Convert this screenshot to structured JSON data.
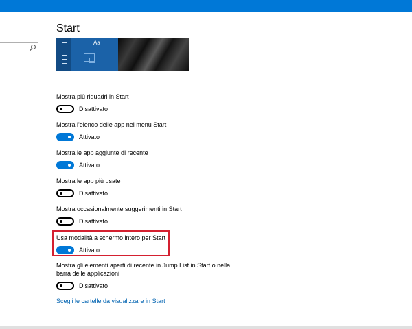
{
  "page": {
    "title": "Start"
  },
  "search": {
    "value": "",
    "placeholder": "",
    "icon": "search-icon"
  },
  "preview": {
    "tile_label": "Aa"
  },
  "settings": [
    {
      "label": "Mostra più riquadri in Start",
      "state": "Disattivato",
      "on": false
    },
    {
      "label": "Mostra l'elenco delle app nel menu Start",
      "state": "Attivato",
      "on": true
    },
    {
      "label": "Mostra le app aggiunte di recente",
      "state": "Attivato",
      "on": true
    },
    {
      "label": "Mostra le app più usate",
      "state": "Disattivato",
      "on": false
    },
    {
      "label": "Mostra occasionalmente suggerimenti in Start",
      "state": "Disattivato",
      "on": false
    },
    {
      "label": "Usa modalità a schermo intero per Start",
      "state": "Attivato",
      "on": true,
      "highlighted": true
    },
    {
      "label_lines": [
        "Mostra gli elementi aperti di recente in Jump List in Start o nella",
        "barra delle applicazioni"
      ],
      "state": "Disattivato",
      "on": false
    }
  ],
  "link": {
    "text": "Scegli le cartelle da visualizzare in Start"
  },
  "colors": {
    "accent": "#0078d7",
    "link": "#0063b1",
    "highlight_border": "#d42030"
  }
}
